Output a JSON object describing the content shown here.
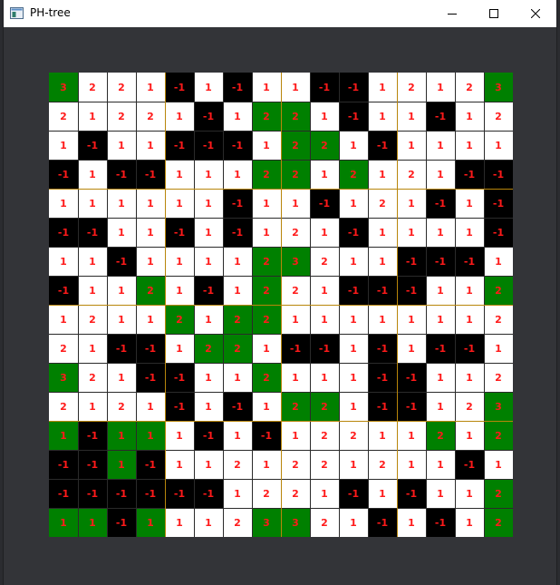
{
  "window": {
    "title": "PH-tree",
    "minimize_glyph": "—",
    "maximize_glyph": "☐",
    "close_glyph": "✕"
  },
  "icons": {
    "app": "app-window-icon",
    "minimize": "minimize-icon",
    "maximize": "maximize-icon",
    "close": "close-icon"
  },
  "colors": {
    "white": "#ffffff",
    "black": "#000000",
    "green": "#008000",
    "number": "#ff1a1a",
    "quadrant_line": "#b8860b",
    "background": "#333438"
  },
  "grid": {
    "values": [
      [
        "3",
        "2",
        "2",
        "1",
        "-1",
        "1",
        "-1",
        "1",
        "1",
        "-1",
        "-1",
        "1",
        "2",
        "1",
        "2",
        "3"
      ],
      [
        "2",
        "1",
        "2",
        "2",
        "1",
        "-1",
        "1",
        "2",
        "2",
        "1",
        "-1",
        "1",
        "1",
        "-1",
        "1",
        "2"
      ],
      [
        "1",
        "-1",
        "1",
        "1",
        "-1",
        "-1",
        "-1",
        "1",
        "2",
        "2",
        "1",
        "-1",
        "1",
        "1",
        "1",
        "1"
      ],
      [
        "-1",
        "1",
        "-1",
        "-1",
        "1",
        "1",
        "1",
        "2",
        "2",
        "1",
        "2",
        "1",
        "2",
        "1",
        "-1",
        "-1"
      ],
      [
        "1",
        "1",
        "1",
        "1",
        "1",
        "1",
        "-1",
        "1",
        "1",
        "-1",
        "1",
        "2",
        "1",
        "-1",
        "1",
        "-1"
      ],
      [
        "-1",
        "-1",
        "1",
        "1",
        "-1",
        "1",
        "-1",
        "1",
        "2",
        "1",
        "-1",
        "1",
        "1",
        "1",
        "1",
        "-1"
      ],
      [
        "1",
        "1",
        "-1",
        "1",
        "1",
        "1",
        "1",
        "2",
        "3",
        "2",
        "1",
        "1",
        "-1",
        "-1",
        "-1",
        "1"
      ],
      [
        "-1",
        "1",
        "1",
        "2",
        "1",
        "-1",
        "1",
        "2",
        "2",
        "1",
        "-1",
        "-1",
        "-1",
        "1",
        "1",
        "2"
      ],
      [
        "1",
        "2",
        "1",
        "1",
        "2",
        "1",
        "2",
        "2",
        "1",
        "1",
        "1",
        "1",
        "1",
        "1",
        "1",
        "2"
      ],
      [
        "2",
        "1",
        "-1",
        "-1",
        "1",
        "2",
        "2",
        "1",
        "-1",
        "-1",
        "1",
        "-1",
        "1",
        "-1",
        "-1",
        "1"
      ],
      [
        "3",
        "2",
        "1",
        "-1",
        "-1",
        "1",
        "1",
        "2",
        "1",
        "1",
        "1",
        "-1",
        "-1",
        "1",
        "1",
        "2"
      ],
      [
        "2",
        "1",
        "2",
        "1",
        "-1",
        "1",
        "-1",
        "1",
        "2",
        "2",
        "1",
        "-1",
        "-1",
        "1",
        "2",
        "3"
      ],
      [
        "1",
        "-1",
        "1",
        "1",
        "1",
        "-1",
        "1",
        "-1",
        "1",
        "2",
        "2",
        "1",
        "1",
        "2",
        "1",
        "2"
      ],
      [
        "-1",
        "-1",
        "1",
        "-1",
        "1",
        "1",
        "2",
        "1",
        "2",
        "2",
        "1",
        "2",
        "1",
        "1",
        "-1",
        "1"
      ],
      [
        "-1",
        "-1",
        "-1",
        "-1",
        "-1",
        "-1",
        "1",
        "2",
        "2",
        "1",
        "-1",
        "1",
        "-1",
        "1",
        "1",
        "2"
      ],
      [
        "1",
        "1",
        "-1",
        "1",
        "1",
        "1",
        "2",
        "3",
        "3",
        "2",
        "1",
        "-1",
        "1",
        "-1",
        "1",
        "2"
      ]
    ],
    "fills": [
      [
        "G",
        "W",
        "W",
        "W",
        "B",
        "W",
        "B",
        "W",
        "W",
        "B",
        "B",
        "W",
        "W",
        "W",
        "W",
        "G"
      ],
      [
        "W",
        "W",
        "W",
        "W",
        "W",
        "B",
        "W",
        "G",
        "G",
        "W",
        "B",
        "W",
        "W",
        "B",
        "W",
        "W"
      ],
      [
        "W",
        "B",
        "W",
        "W",
        "B",
        "B",
        "B",
        "W",
        "G",
        "G",
        "W",
        "B",
        "W",
        "W",
        "W",
        "W"
      ],
      [
        "B",
        "W",
        "B",
        "B",
        "W",
        "W",
        "W",
        "G",
        "G",
        "W",
        "G",
        "W",
        "W",
        "W",
        "B",
        "B"
      ],
      [
        "W",
        "W",
        "W",
        "W",
        "W",
        "W",
        "B",
        "W",
        "W",
        "B",
        "W",
        "W",
        "W",
        "B",
        "W",
        "B"
      ],
      [
        "B",
        "B",
        "W",
        "W",
        "B",
        "W",
        "B",
        "W",
        "W",
        "W",
        "B",
        "W",
        "W",
        "W",
        "W",
        "B"
      ],
      [
        "W",
        "W",
        "B",
        "W",
        "W",
        "W",
        "W",
        "G",
        "G",
        "W",
        "W",
        "W",
        "B",
        "B",
        "B",
        "W"
      ],
      [
        "B",
        "W",
        "W",
        "G",
        "W",
        "B",
        "W",
        "G",
        "W",
        "W",
        "B",
        "B",
        "B",
        "W",
        "W",
        "G"
      ],
      [
        "W",
        "W",
        "W",
        "W",
        "G",
        "W",
        "G",
        "G",
        "W",
        "W",
        "W",
        "W",
        "W",
        "W",
        "W",
        "W"
      ],
      [
        "W",
        "W",
        "B",
        "B",
        "W",
        "G",
        "G",
        "W",
        "B",
        "B",
        "W",
        "B",
        "W",
        "B",
        "B",
        "W"
      ],
      [
        "G",
        "W",
        "W",
        "B",
        "B",
        "W",
        "W",
        "G",
        "W",
        "W",
        "W",
        "B",
        "B",
        "W",
        "W",
        "W"
      ],
      [
        "W",
        "W",
        "W",
        "W",
        "B",
        "W",
        "B",
        "W",
        "G",
        "G",
        "W",
        "B",
        "B",
        "W",
        "W",
        "G"
      ],
      [
        "G",
        "B",
        "G",
        "G",
        "W",
        "B",
        "W",
        "B",
        "W",
        "W",
        "W",
        "W",
        "W",
        "G",
        "W",
        "G"
      ],
      [
        "B",
        "B",
        "G",
        "B",
        "W",
        "W",
        "W",
        "W",
        "W",
        "W",
        "W",
        "W",
        "W",
        "W",
        "B",
        "W"
      ],
      [
        "B",
        "B",
        "B",
        "B",
        "B",
        "B",
        "W",
        "W",
        "W",
        "W",
        "B",
        "W",
        "B",
        "W",
        "W",
        "G"
      ],
      [
        "G",
        "G",
        "B",
        "G",
        "W",
        "W",
        "W",
        "G",
        "G",
        "W",
        "W",
        "B",
        "W",
        "B",
        "W",
        "G"
      ]
    ]
  }
}
